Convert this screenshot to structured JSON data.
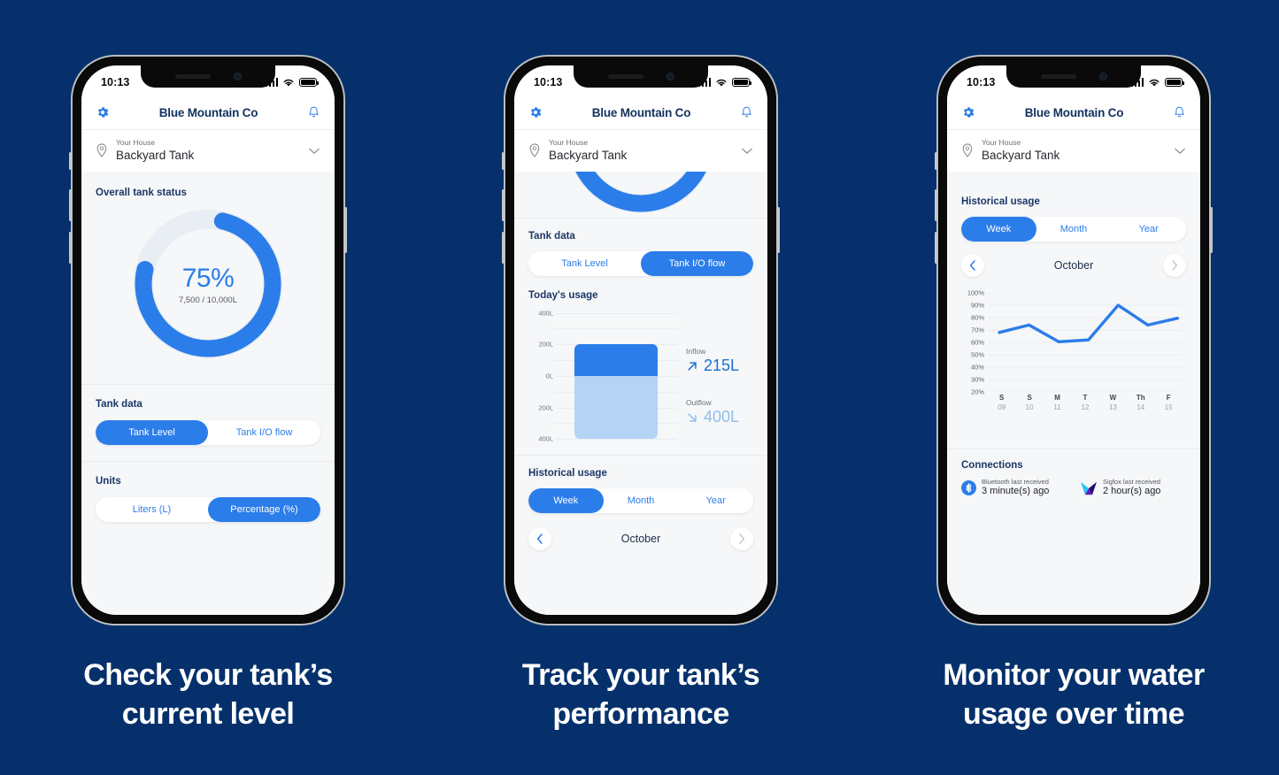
{
  "brand": "Blue Mountain Co",
  "status": {
    "time": "10:13",
    "signal_icon": "cellular-bars-icon",
    "wifi_icon": "wifi-icon",
    "battery_icon": "battery-full-icon"
  },
  "header": {
    "settings_icon": "gear-icon",
    "notifications_icon": "bell-icon"
  },
  "selector": {
    "sublabel": "Your House",
    "label": "Backyard Tank",
    "location_icon": "location-pin-icon",
    "chevron_icon": "chevron-down-icon"
  },
  "screen1": {
    "status_title": "Overall tank status",
    "gauge": {
      "percent_label": "75%",
      "volume_label": "7,500 / 10,000L",
      "percent": 75
    },
    "tank_data_title": "Tank data",
    "tank_data_options": [
      "Tank Level",
      "Tank I/O flow"
    ],
    "tank_data_selected": "Tank Level",
    "units_title": "Units",
    "units_options": [
      "Liters (L)",
      "Percentage (%)"
    ],
    "units_selected": "Percentage (%)"
  },
  "screen2": {
    "tank_data_title": "Tank data",
    "tank_data_options": [
      "Tank Level",
      "Tank I/O flow"
    ],
    "tank_data_selected": "Tank I/O flow",
    "today_title": "Today's usage",
    "inflow_label": "Inflow",
    "inflow_value": "215L",
    "inflow_icon": "arrow-up-right-icon",
    "outflow_label": "Outflow",
    "outflow_value": "400L",
    "outflow_icon": "arrow-down-right-icon",
    "historical_title": "Historical usage",
    "range_options": [
      "Week",
      "Month",
      "Year"
    ],
    "range_selected": "Week",
    "month": "October",
    "prev_icon": "chevron-left-icon",
    "next_icon": "chevron-right-icon"
  },
  "screen3": {
    "historical_title": "Historical usage",
    "range_options": [
      "Week",
      "Month",
      "Year"
    ],
    "range_selected": "Week",
    "month": "October",
    "prev_icon": "chevron-left-icon",
    "next_icon": "chevron-right-icon",
    "connections_title": "Connections",
    "connections": [
      {
        "icon": "bluetooth-icon",
        "label": "Bluetooth last received",
        "value": "3 minute(s) ago"
      },
      {
        "icon": "sigfox-icon",
        "label": "Sigfox last received",
        "value": "2 hour(s) ago"
      }
    ]
  },
  "captions": [
    "Check your tank’s\ncurrent level",
    "Track your tank’s\nperformance",
    "Monitor your water\nusage over time"
  ],
  "colors": {
    "background": "#05306B",
    "accent": "#2B7DE9",
    "accent_light": "#B4D3F5",
    "navy_text": "#1B3766",
    "card": "#FFFFFF",
    "surface": "#F6F7F8"
  },
  "chart_data": [
    {
      "type": "bar",
      "title": "Today's usage",
      "categories": [
        "Inflow",
        "Outflow"
      ],
      "values": [
        215,
        -400
      ],
      "ylabel": "",
      "ytick_labels": [
        "400L",
        "200L",
        "0L",
        "200L",
        "400L"
      ],
      "ytick_values": [
        400,
        200,
        0,
        -200,
        -400
      ],
      "ylim": [
        -400,
        400
      ],
      "grid": true,
      "legend": "none",
      "series": [
        {
          "name": "Inflow",
          "value": 215,
          "color": "#2B7DE9"
        },
        {
          "name": "Outflow",
          "value": 400,
          "color": "#B4D3F5"
        }
      ]
    },
    {
      "type": "line",
      "title": "Historical usage",
      "subtitle": "October",
      "xlabel": "",
      "ylabel": "",
      "ylim": [
        20,
        100
      ],
      "grid": true,
      "legend": "none",
      "ytick_labels": [
        "100%",
        "90%",
        "80%",
        "70%",
        "60%",
        "50%",
        "40%",
        "30%",
        "20%"
      ],
      "ytick_values": [
        100,
        90,
        80,
        70,
        60,
        50,
        40,
        30,
        20
      ],
      "categories": [
        "S",
        "S",
        "M",
        "T",
        "W",
        "Th",
        "F"
      ],
      "x_subticks": [
        "09",
        "10",
        "11",
        "12",
        "13",
        "14",
        "15"
      ],
      "values": [
        68,
        74,
        60.5,
        62,
        90,
        74,
        79.5
      ],
      "line_color": "#2B7DE9"
    }
  ]
}
